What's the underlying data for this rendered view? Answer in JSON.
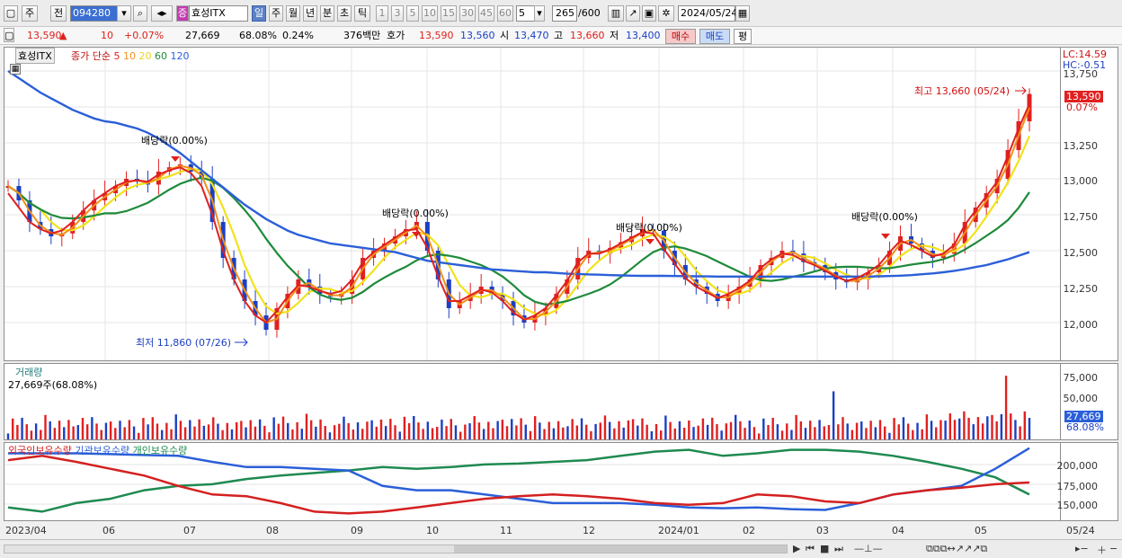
{
  "toolbar": {
    "mode": "주",
    "prev": "전",
    "code": "094280",
    "name": "효성ITX",
    "periods": [
      "일",
      "주",
      "월",
      "년",
      "분",
      "초",
      "틱"
    ],
    "multipliers": [
      "1",
      "3",
      "5",
      "10",
      "15",
      "30",
      "45",
      "60"
    ],
    "interval": "5",
    "count": "265",
    "count_max": "/600",
    "date": "2024/05/24"
  },
  "quote": {
    "price": "13,590",
    "arrow": "▲",
    "change": "10",
    "change_pct": "+0.07%",
    "volume": "27,669",
    "vol_ratio": "68.08%",
    "turnover": "0.24%",
    "amount": "376백만",
    "bid_label": "호가",
    "ask": "13,590",
    "bid": "13,560",
    "open_label": "시",
    "open": "13,470",
    "high_label": "고",
    "high": "13,660",
    "low_label": "저",
    "low": "13,400",
    "buy": "매수",
    "sell": "매도",
    "even": "평"
  },
  "price_pane": {
    "name": "효성ITX",
    "legend_prefix": "종가 단순",
    "ma": [
      {
        "label": "5",
        "color": "#e02020"
      },
      {
        "label": "10",
        "color": "#f0901a"
      },
      {
        "label": "20",
        "color": "#f2e21a"
      },
      {
        "label": "60",
        "color": "#1e8a3a"
      },
      {
        "label": "120",
        "color": "#2b5fd8"
      }
    ],
    "lc": "LC:14.59",
    "hc": "HC:-0.51",
    "last_price": "13,590",
    "last_pct": "0.07%",
    "high_annot": "최고 13,660 (05/24)",
    "low_annot": "최저 11,860 (07/26)",
    "dividend": "배당락(0.00%)",
    "yticks": [
      "13,750",
      "13,500",
      "13,250",
      "13,000",
      "12,750",
      "12,500",
      "12,250",
      "12,000"
    ]
  },
  "volume_pane": {
    "title": "거래량",
    "subtitle": "27,669주(68.08%)",
    "yticks": [
      "75,000",
      "50,000",
      "25,000"
    ],
    "last": "27,669",
    "last_pct": "68.08%"
  },
  "holdings_pane": {
    "legend": [
      {
        "label": "외국인보유수량",
        "color": "#d42020"
      },
      {
        "label": "기관보유수량",
        "color": "#2b5fd8"
      },
      {
        "label": "개인보유수량",
        "color": "#1e8a50"
      }
    ],
    "yticks": [
      "200,000",
      "175,000",
      "150,000"
    ]
  },
  "xaxis": [
    "2023/04",
    "06",
    "07",
    "08",
    "09",
    "10",
    "11",
    "12",
    "2024/01",
    "02",
    "03",
    "04",
    "05",
    "05/24"
  ],
  "chart_data": {
    "type": "line",
    "title": "",
    "xlabel": "",
    "ylabel": "",
    "series": [
      {
        "name": "종가",
        "values": [
          12950,
          12850,
          12700,
          12650,
          12600,
          12620,
          12700,
          12780,
          12850,
          12900,
          12950,
          13000,
          12980,
          12960,
          13050,
          13080,
          13100,
          13050,
          13000,
          12700,
          12450,
          12300,
          12150,
          12050,
          11950,
          12100,
          12200,
          12300,
          12250,
          12200,
          12180,
          12200,
          12300,
          12450,
          12500,
          12550,
          12600,
          12650,
          12700,
          12500,
          12300,
          12100,
          12150,
          12200,
          12250,
          12200,
          12150,
          12050,
          12000,
          12050,
          12100,
          12200,
          12300,
          12450,
          12500,
          12480,
          12520,
          12560,
          12600,
          12650,
          12640,
          12500,
          12400,
          12300,
          12250,
          12200,
          12150,
          12200,
          12250,
          12300,
          12400,
          12450,
          12500,
          12480,
          12420,
          12400,
          12350,
          12300,
          12280,
          12300,
          12350,
          12400,
          12500,
          12600,
          12550,
          12500,
          12450,
          12480,
          12550,
          12700,
          12800,
          12900,
          13000,
          13200,
          13400,
          13590
        ]
      },
      {
        "name": "5",
        "values": [
          12900,
          12800,
          12700,
          12650,
          12620,
          12640,
          12700,
          12780,
          12850,
          12900,
          12950,
          12980,
          12990,
          12980,
          13030,
          13060,
          13080,
          13040,
          12950,
          12750,
          12500,
          12300,
          12150,
          12050,
          12000,
          12080,
          12180,
          12260,
          12250,
          12220,
          12200,
          12220,
          12300,
          12420,
          12490,
          12540,
          12590,
          12640,
          12650,
          12520,
          12320,
          12150,
          12150,
          12190,
          12230,
          12210,
          12150,
          12070,
          12020,
          12050,
          12100,
          12190,
          12290,
          12420,
          12480,
          12480,
          12510,
          12550,
          12590,
          12630,
          12620,
          12510,
          12410,
          12310,
          12250,
          12210,
          12170,
          12200,
          12240,
          12290,
          12380,
          12440,
          12480,
          12470,
          12430,
          12400,
          12360,
          12320,
          12290,
          12310,
          12350,
          12400,
          12490,
          12570,
          12540,
          12500,
          12460,
          12480,
          12540,
          12680,
          12780,
          12880,
          12980,
          13160,
          13350,
          13520
        ]
      },
      {
        "name": "120",
        "values": [
          13750,
          13700,
          13650,
          13600,
          13560,
          13520,
          13480,
          13450,
          13420,
          13400,
          13390,
          13370,
          13350,
          13320,
          13280,
          13230,
          13180,
          13120,
          13060,
          13000,
          12940,
          12880,
          12820,
          12770,
          12720,
          12680,
          12640,
          12610,
          12590,
          12570,
          12550,
          12540,
          12530,
          12520,
          12510,
          12500,
          12490,
          12470,
          12450,
          12430,
          12420,
          12410,
          12400,
          12390,
          12380,
          12370,
          12365,
          12360,
          12355,
          12350,
          12350,
          12345,
          12340,
          12338,
          12335,
          12333,
          12330,
          12328,
          12326,
          12325,
          12325,
          12325,
          12324,
          12323,
          12322,
          12321,
          12320,
          12320,
          12320,
          12320,
          12320,
          12320,
          12320,
          12320,
          12320,
          12320,
          12320,
          12320,
          12320,
          12320,
          12320,
          12322,
          12324,
          12326,
          12330,
          12336,
          12342,
          12350,
          12360,
          12372,
          12386,
          12400,
          12420,
          12440,
          12465,
          12490
        ]
      }
    ],
    "volume": {
      "last": 27669,
      "peaks": [
        65000,
        78000
      ]
    },
    "holdings": {
      "x": [
        "2023/04",
        "06",
        "07",
        "08",
        "09",
        "10",
        "11",
        "12",
        "2024/01",
        "02",
        "03",
        "04",
        "05",
        "05/24"
      ],
      "ylim": [
        130000,
        220000
      ]
    },
    "ylim": [
      11800,
      13850
    ],
    "grid": true
  }
}
